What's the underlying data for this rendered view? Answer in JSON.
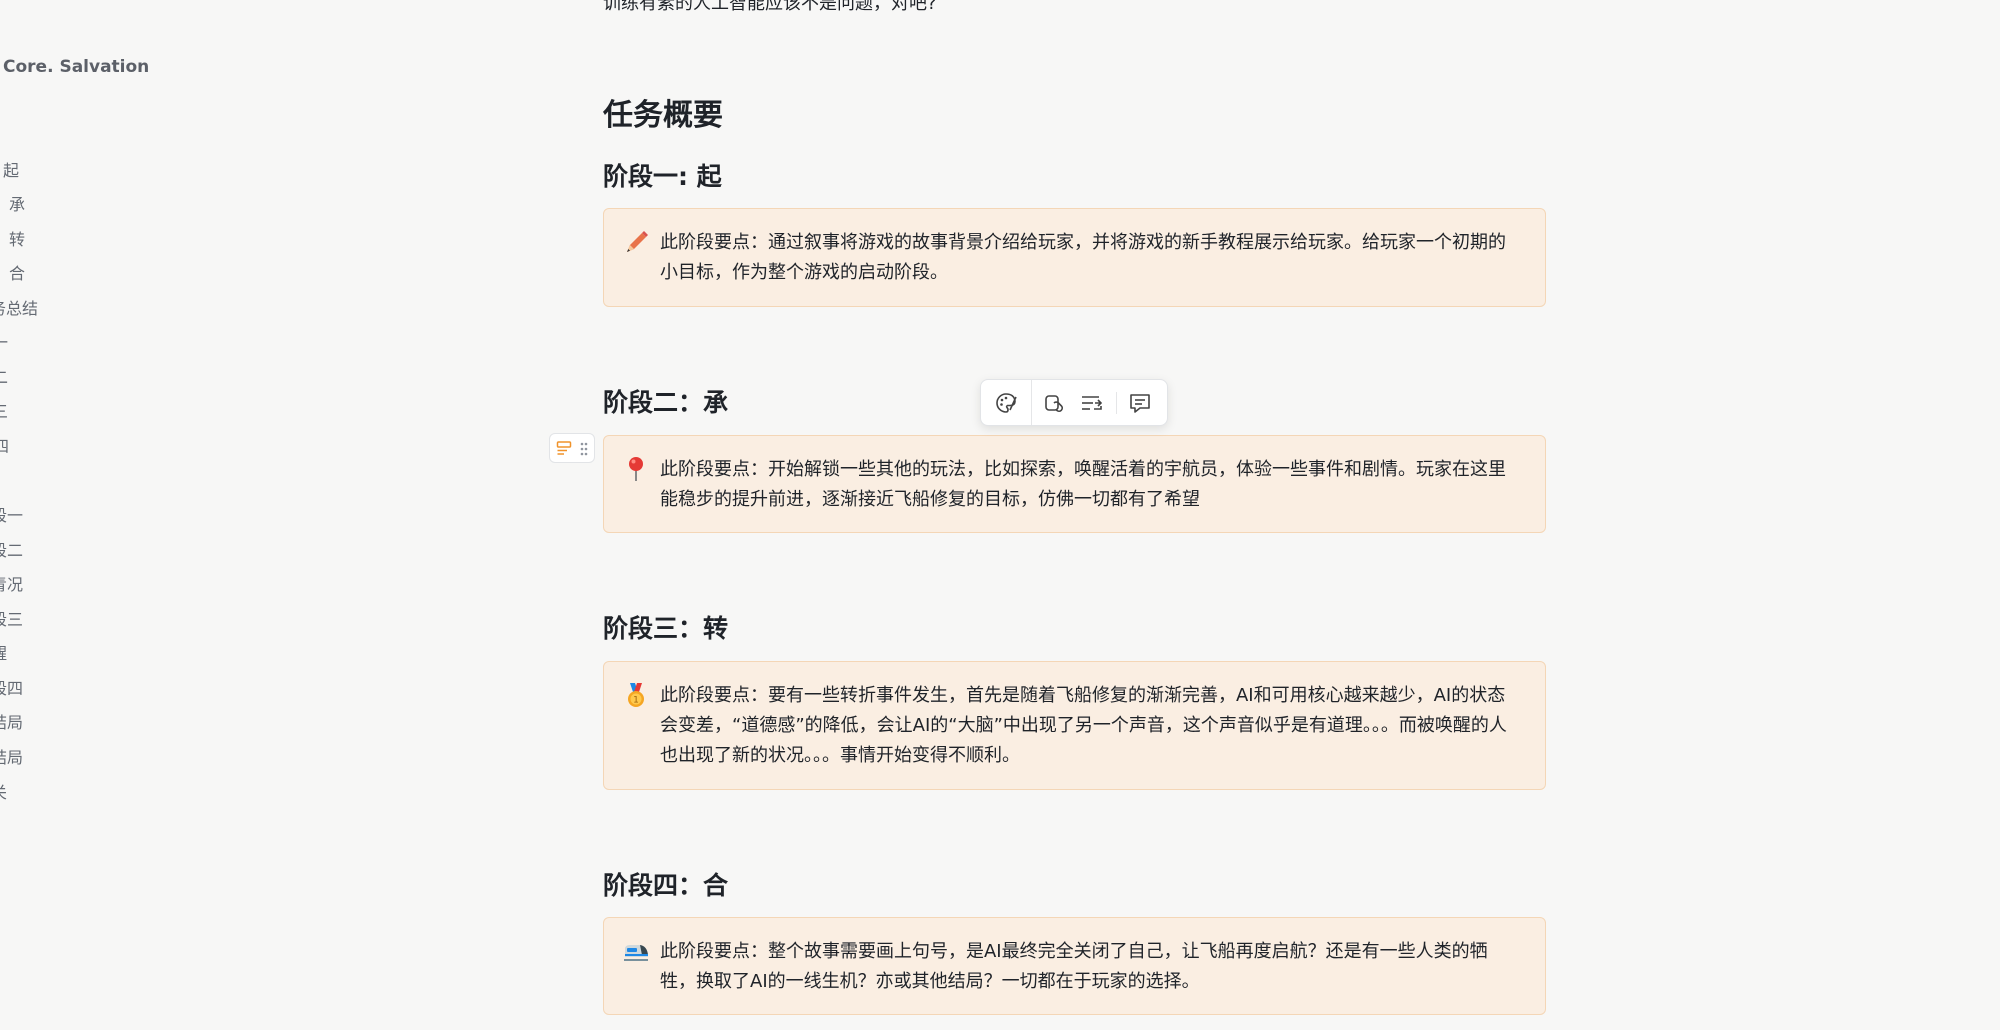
{
  "sidebar": {
    "title": "Core. Salvation",
    "items": [
      {
        "label": "起"
      },
      {
        "label": "承"
      },
      {
        "label": "转"
      },
      {
        "label": "合"
      },
      {
        "label": "务总结"
      },
      {
        "label": "一"
      },
      {
        "label": "二"
      },
      {
        "label": "三"
      },
      {
        "label": "四"
      },
      {
        "label": "段一"
      },
      {
        "label": "段二"
      },
      {
        "label": "青况"
      },
      {
        "label": "段三"
      },
      {
        "label": "醒"
      },
      {
        "label": "段四"
      },
      {
        "label": "结局"
      },
      {
        "label": "结局"
      },
      {
        "label": "关"
      }
    ]
  },
  "document": {
    "top_fragment": "训练有素的人工智能应该不是问题，对吧?",
    "section_heading": "任务概要",
    "stages": [
      {
        "heading": "阶段一: 起",
        "icon": "pencil-icon",
        "text": "此阶段要点：通过叙事将游戏的故事背景介绍给玩家，并将游戏的新手教程展示给玩家。给玩家一个初期的小目标，作为整个游戏的启动阶段。"
      },
      {
        "heading": "阶段二：承",
        "icon": "pushpin-icon",
        "text": "此阶段要点：开始解锁一些其他的玩法，比如探索，唤醒活着的宇航员，体验一些事件和剧情。玩家在这里能稳步的提升前进，逐渐接近飞船修复的目标，仿佛一切都有了希望"
      },
      {
        "heading": "阶段三：转",
        "icon": "medal-icon",
        "text": "此阶段要点：要有一些转折事件发生，首先是随着飞船修复的渐渐完善，AI和可用核心越来越少，AI的状态会变差，“道德感”的降低，会让AI的“大脑”中出现了另一个声音，这个声音似乎是有道理。。。而被唤醒的人也出现了新的状况。。。事情开始变得不顺利。"
      },
      {
        "heading": "阶段四：合",
        "icon": "bullet-train-icon",
        "text": "此阶段要点：整个故事需要画上句号，是AI最终完全关闭了自己，让飞船再度启航？还是有一些人类的牺牲，换取了AI的一线生机？亦或其他结局？一切都在于玩家的选择。"
      }
    ]
  },
  "toolbar": {
    "buttons": [
      "palette-icon",
      "link-icon",
      "text-wrap-icon",
      "comment-icon"
    ]
  },
  "colors": {
    "callout_bg": "#faeee2",
    "callout_border": "#f4d6b6",
    "page_bg": "#f7f7f6"
  }
}
